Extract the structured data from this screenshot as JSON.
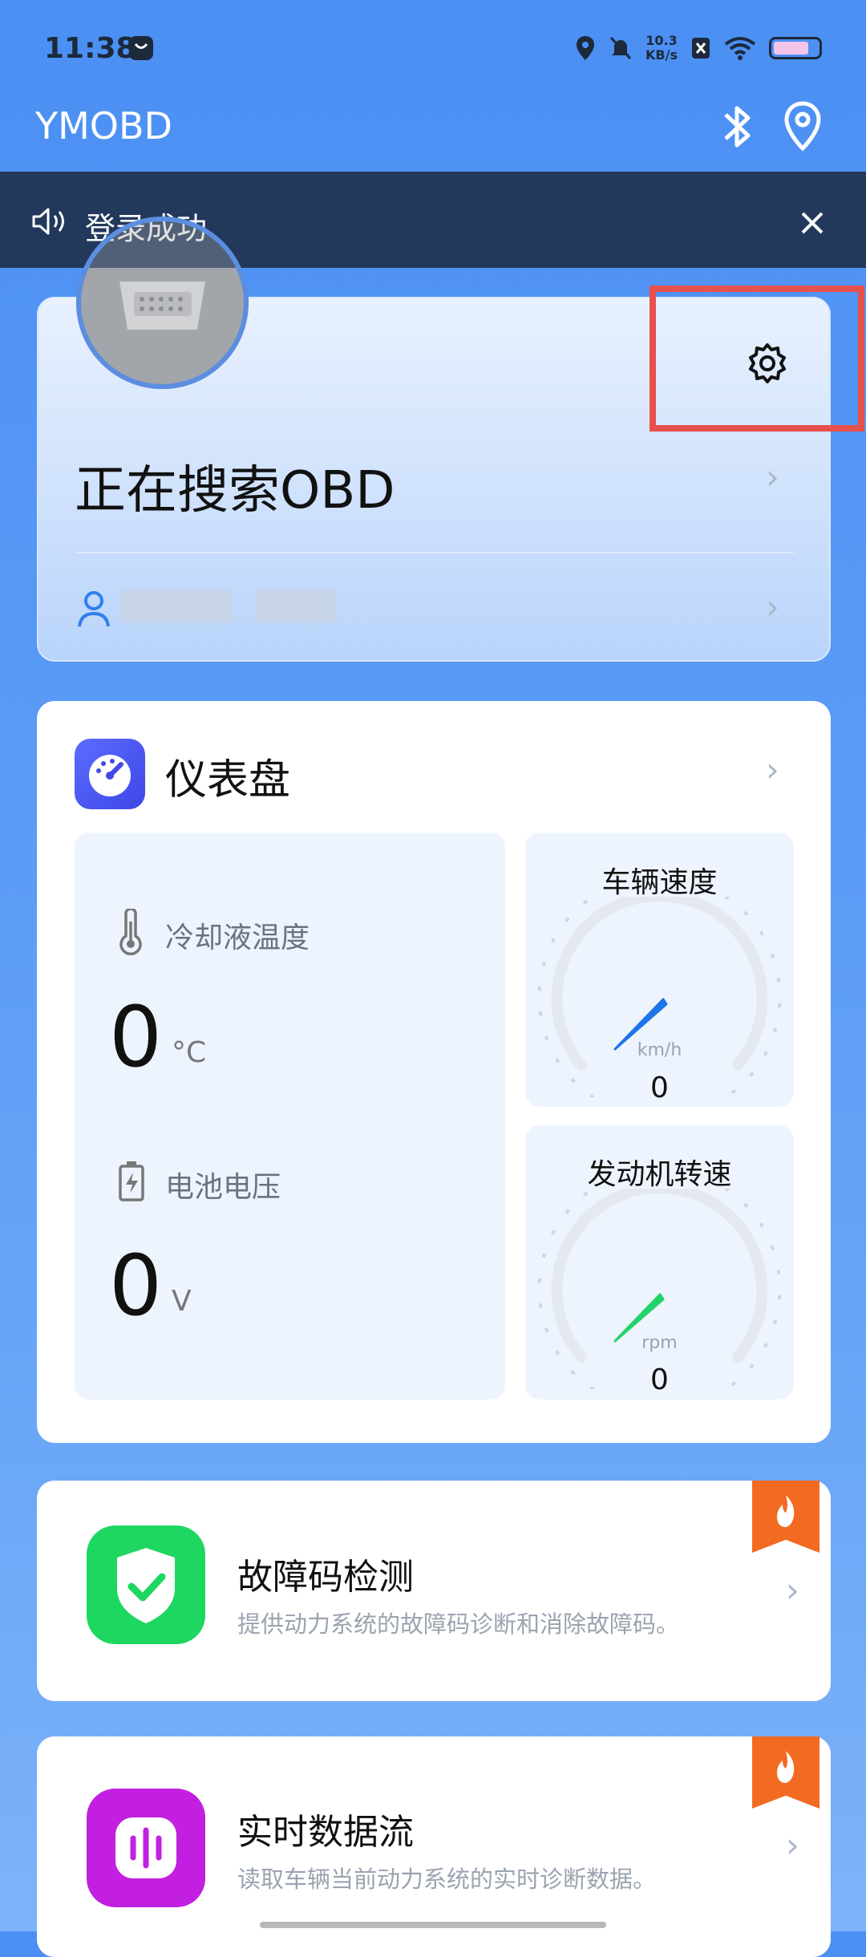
{
  "status_bar": {
    "time": "11:38",
    "net_speed_value": "10.3",
    "net_speed_unit": "KB/s"
  },
  "app": {
    "title": "YMOBD"
  },
  "notice": {
    "text": "登录成功"
  },
  "device_card": {
    "status": "正在搜索OBD"
  },
  "dashboard": {
    "title": "仪表盘",
    "coolant": {
      "label": "冷却液温度",
      "value": "0",
      "unit": "°C"
    },
    "battery": {
      "label": "电池电压",
      "value": "0",
      "unit": "V"
    },
    "speed": {
      "title": "车辆速度",
      "unit": "km/h",
      "value": "0"
    },
    "rpm": {
      "title": "发动机转速",
      "unit": "rpm",
      "value": "0"
    }
  },
  "features": [
    {
      "title": "故障码检测",
      "desc": "提供动力系统的故障码诊断和消除故障码。"
    },
    {
      "title": "实时数据流",
      "desc": "读取车辆当前动力系统的实时诊断数据。"
    }
  ],
  "colors": {
    "background": "#4b8ff4",
    "notice_bg": "#22395c",
    "highlight_box": "#e7504c",
    "speed_needle": "#1e74e8",
    "rpm_needle": "#22d36a",
    "hot_ribbon": "#f26b21"
  }
}
